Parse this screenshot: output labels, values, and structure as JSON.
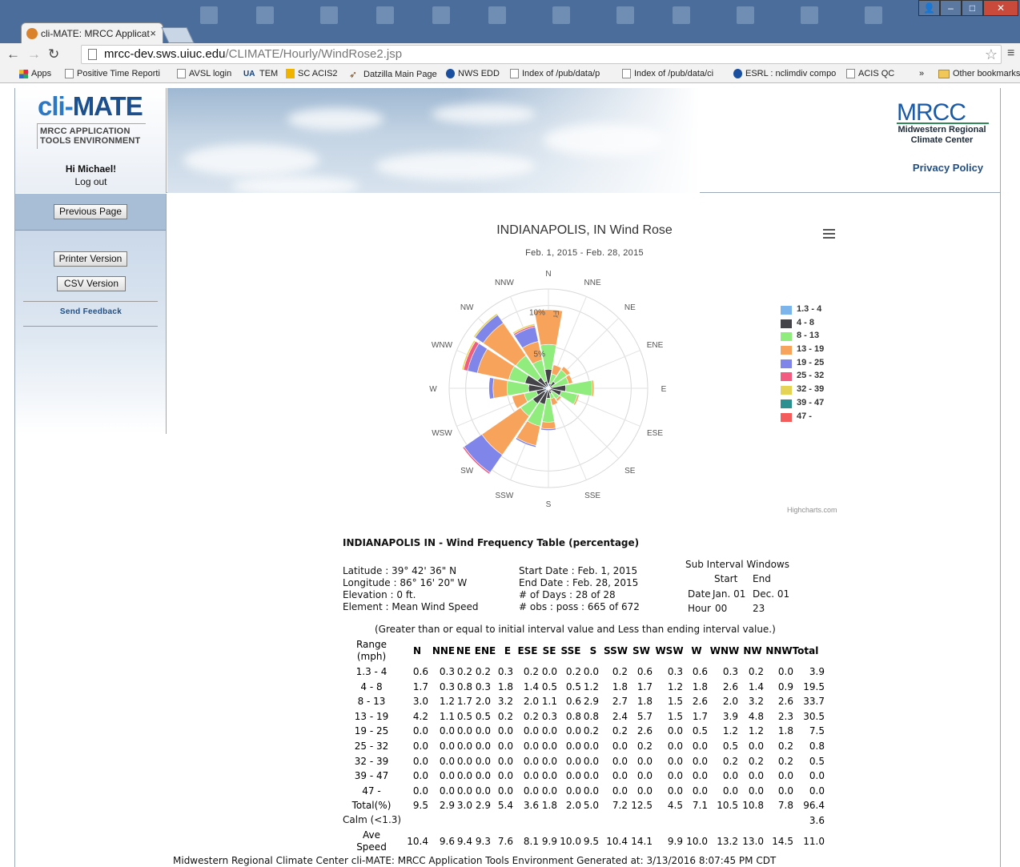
{
  "browser": {
    "tab_title": "cli-MATE: MRCC Applicat",
    "tab_close": "×",
    "url_host": "mrcc-dev.sws.uiuc.edu",
    "url_path": "/CLIMATE/Hourly/WindRose2.jsp",
    "bookmarks": [
      {
        "label": "Apps",
        "icon": "apps-icon"
      },
      {
        "label": "Positive Time Reporti",
        "icon": "page-icon"
      },
      {
        "label": "AVSL login",
        "icon": "page-icon"
      },
      {
        "label": "TEM",
        "icon": "ua-icon"
      },
      {
        "label": "SC ACIS2",
        "icon": "sc-icon"
      },
      {
        "label": "Datzilla Main Page",
        "icon": "datzilla-icon"
      },
      {
        "label": "NWS EDD",
        "icon": "nws-icon"
      },
      {
        "label": "Index of /pub/data/p",
        "icon": "page-icon"
      },
      {
        "label": "Index of /pub/data/ci",
        "icon": "page-icon"
      },
      {
        "label": "ESRL : nclimdiv compo",
        "icon": "nws-icon"
      },
      {
        "label": "ACIS QC",
        "icon": "page-icon"
      },
      {
        "label": "»",
        "icon": ""
      },
      {
        "label": "Other bookmarks",
        "icon": "folder-icon"
      }
    ],
    "ua_text": "UA"
  },
  "header": {
    "logo_cli": "cli-",
    "logo_mate": "MATE",
    "logo_subtitle_1": "MRCC APPLICATION",
    "logo_subtitle_2": "TOOLS ENVIRONMENT",
    "greeting": "Hi Michael!",
    "logout": "Log out",
    "mrcc": "MRCC",
    "mrcc_sub_1": "Midwestern Regional",
    "mrcc_sub_2": "Climate Center",
    "privacy": "Privacy Policy"
  },
  "sidebar": {
    "previous_page": "Previous Page",
    "printer_version": "Printer Version",
    "csv_version": "CSV Version",
    "send_feedback": "Send Feedback"
  },
  "chart": {
    "menu_icon": "hamburger-menu-icon",
    "credits": "Highcharts.com"
  },
  "chart_data": {
    "type": "wind-rose (stacked polar column)",
    "title": "INDIANAPOLIS, IN Wind Rose",
    "subtitle": "Feb. 1, 2015 - Feb. 28, 2015",
    "radial_ticks": [
      "5%",
      "10%"
    ],
    "radial_max": 12,
    "radial_axis_label": "Fr",
    "directions": [
      "N",
      "NNE",
      "NE",
      "ENE",
      "E",
      "ESE",
      "SE",
      "SSE",
      "S",
      "SSW",
      "SW",
      "WSW",
      "W",
      "WNW",
      "NW",
      "NNW"
    ],
    "legend_position": "right",
    "series": [
      {
        "name": "1.3 - 4",
        "color": "#7cb5ec",
        "values": [
          0.6,
          0.3,
          0.2,
          0.2,
          0.3,
          0.2,
          0.0,
          0.2,
          0.0,
          0.2,
          0.6,
          0.3,
          0.6,
          0.3,
          0.2,
          0.0
        ]
      },
      {
        "name": "4 - 8",
        "color": "#434348",
        "values": [
          1.7,
          0.3,
          0.8,
          0.3,
          1.8,
          1.4,
          0.5,
          0.5,
          1.2,
          1.8,
          1.7,
          1.2,
          1.8,
          2.6,
          1.4,
          0.9
        ]
      },
      {
        "name": "8 - 13",
        "color": "#90ed7d",
        "values": [
          3.0,
          1.2,
          1.7,
          2.0,
          3.2,
          2.0,
          1.1,
          0.6,
          2.9,
          2.7,
          1.8,
          1.5,
          2.6,
          2.0,
          3.2,
          2.6
        ]
      },
      {
        "name": "13 - 19",
        "color": "#f7a35c",
        "values": [
          4.2,
          1.1,
          0.5,
          0.5,
          0.2,
          0.2,
          0.3,
          0.8,
          0.8,
          2.4,
          5.7,
          1.5,
          1.7,
          3.9,
          4.8,
          2.3
        ]
      },
      {
        "name": "19 - 25",
        "color": "#8085e9",
        "values": [
          0.0,
          0.0,
          0.0,
          0.0,
          0.0,
          0.0,
          0.0,
          0.0,
          0.2,
          0.2,
          2.6,
          0.0,
          0.5,
          1.2,
          1.2,
          1.8
        ]
      },
      {
        "name": "25 - 32",
        "color": "#f15c80",
        "values": [
          0.0,
          0.0,
          0.0,
          0.0,
          0.0,
          0.0,
          0.0,
          0.0,
          0.0,
          0.0,
          0.2,
          0.0,
          0.0,
          0.5,
          0.0,
          0.2
        ]
      },
      {
        "name": "32 - 39",
        "color": "#e4d354",
        "values": [
          0.0,
          0.0,
          0.0,
          0.0,
          0.0,
          0.0,
          0.0,
          0.0,
          0.0,
          0.0,
          0.0,
          0.0,
          0.0,
          0.2,
          0.2,
          0.2
        ]
      },
      {
        "name": "39 - 47",
        "color": "#2b908f",
        "values": [
          0.0,
          0.0,
          0.0,
          0.0,
          0.0,
          0.0,
          0.0,
          0.0,
          0.0,
          0.0,
          0.0,
          0.0,
          0.0,
          0.0,
          0.0,
          0.0
        ]
      },
      {
        "name": "47 -",
        "color": "#f45b5b",
        "values": [
          0.0,
          0.0,
          0.0,
          0.0,
          0.0,
          0.0,
          0.0,
          0.0,
          0.0,
          0.0,
          0.0,
          0.0,
          0.0,
          0.0,
          0.0,
          0.0
        ]
      }
    ]
  },
  "table": {
    "title": "INDIANAPOLIS IN - Wind Frequency Table (percentage)",
    "latitude": "Latitude : 39° 42' 36\" N",
    "longitude": "Longitude : 86° 16' 20\" W",
    "elevation": "Elevation : 0 ft.",
    "element": "Element : Mean Wind Speed",
    "start_date": "Start Date : Feb. 1, 2015",
    "end_date": "End Date : Feb. 28, 2015",
    "days": "# of Days : 28 of 28",
    "obs": "# obs : poss : 665 of 672",
    "sub_interval_title": "Sub Interval Windows",
    "sub_start": "Start",
    "sub_end": "End",
    "date_label": "Date",
    "date_start": "Jan. 01",
    "date_end": "Dec. 01",
    "hour_label": "Hour",
    "hour_start": "00",
    "hour_end": "23",
    "note": "(Greater than or equal to initial interval value and Less than ending interval value.)",
    "range_header_1": "Range",
    "range_header_2": "(mph)",
    "columns": [
      "N",
      "NNE",
      "NE",
      "ENE",
      "E",
      "ESE",
      "SE",
      "SSE",
      "S",
      "SSW",
      "SW",
      "WSW",
      "W",
      "WNW",
      "NW",
      "NNW",
      "Total"
    ],
    "rows": [
      {
        "label": "1.3 - 4",
        "values": [
          "0.6",
          "0.3",
          "0.2",
          "0.2",
          "0.3",
          "0.2",
          "0.0",
          "0.2",
          "0.0",
          "0.2",
          "0.6",
          "0.3",
          "0.6",
          "0.3",
          "0.2",
          "0.0",
          "3.9"
        ]
      },
      {
        "label": "4 - 8",
        "values": [
          "1.7",
          "0.3",
          "0.8",
          "0.3",
          "1.8",
          "1.4",
          "0.5",
          "0.5",
          "1.2",
          "1.8",
          "1.7",
          "1.2",
          "1.8",
          "2.6",
          "1.4",
          "0.9",
          "19.5"
        ]
      },
      {
        "label": "8 - 13",
        "values": [
          "3.0",
          "1.2",
          "1.7",
          "2.0",
          "3.2",
          "2.0",
          "1.1",
          "0.6",
          "2.9",
          "2.7",
          "1.8",
          "1.5",
          "2.6",
          "2.0",
          "3.2",
          "2.6",
          "33.7"
        ]
      },
      {
        "label": "13 - 19",
        "values": [
          "4.2",
          "1.1",
          "0.5",
          "0.5",
          "0.2",
          "0.2",
          "0.3",
          "0.8",
          "0.8",
          "2.4",
          "5.7",
          "1.5",
          "1.7",
          "3.9",
          "4.8",
          "2.3",
          "30.5"
        ]
      },
      {
        "label": "19 - 25",
        "values": [
          "0.0",
          "0.0",
          "0.0",
          "0.0",
          "0.0",
          "0.0",
          "0.0",
          "0.0",
          "0.2",
          "0.2",
          "2.6",
          "0.0",
          "0.5",
          "1.2",
          "1.2",
          "1.8",
          "7.5"
        ]
      },
      {
        "label": "25 - 32",
        "values": [
          "0.0",
          "0.0",
          "0.0",
          "0.0",
          "0.0",
          "0.0",
          "0.0",
          "0.0",
          "0.0",
          "0.0",
          "0.2",
          "0.0",
          "0.0",
          "0.5",
          "0.0",
          "0.2",
          "0.8"
        ]
      },
      {
        "label": "32 - 39",
        "values": [
          "0.0",
          "0.0",
          "0.0",
          "0.0",
          "0.0",
          "0.0",
          "0.0",
          "0.0",
          "0.0",
          "0.0",
          "0.0",
          "0.0",
          "0.0",
          "0.2",
          "0.2",
          "0.2",
          "0.5"
        ]
      },
      {
        "label": "39 - 47",
        "values": [
          "0.0",
          "0.0",
          "0.0",
          "0.0",
          "0.0",
          "0.0",
          "0.0",
          "0.0",
          "0.0",
          "0.0",
          "0.0",
          "0.0",
          "0.0",
          "0.0",
          "0.0",
          "0.0",
          "0.0"
        ]
      },
      {
        "label": "47 -",
        "values": [
          "0.0",
          "0.0",
          "0.0",
          "0.0",
          "0.0",
          "0.0",
          "0.0",
          "0.0",
          "0.0",
          "0.0",
          "0.0",
          "0.0",
          "0.0",
          "0.0",
          "0.0",
          "0.0",
          "0.0"
        ]
      },
      {
        "label": "Total(%)",
        "values": [
          "9.5",
          "2.9",
          "3.0",
          "2.9",
          "5.4",
          "3.6",
          "1.8",
          "2.0",
          "5.0",
          "7.2",
          "12.5",
          "4.5",
          "7.1",
          "10.5",
          "10.8",
          "7.8",
          "96.4"
        ]
      }
    ],
    "calm_label": "Calm (<1.3)",
    "calm_value": "3.6",
    "ave_label_1": "Ave",
    "ave_label_2": "Speed",
    "ave_values": [
      "10.4",
      "9.6",
      "9.4",
      "9.3",
      "7.6",
      "8.1",
      "9.9",
      "10.0",
      "9.5",
      "10.4",
      "14.1",
      "9.9",
      "10.0",
      "13.2",
      "13.0",
      "14.5",
      "11.0"
    ]
  },
  "footer": "Midwestern Regional Climate Center cli-MATE: MRCC Application Tools Environment Generated at: 3/13/2016 8:07:45 PM CDT"
}
